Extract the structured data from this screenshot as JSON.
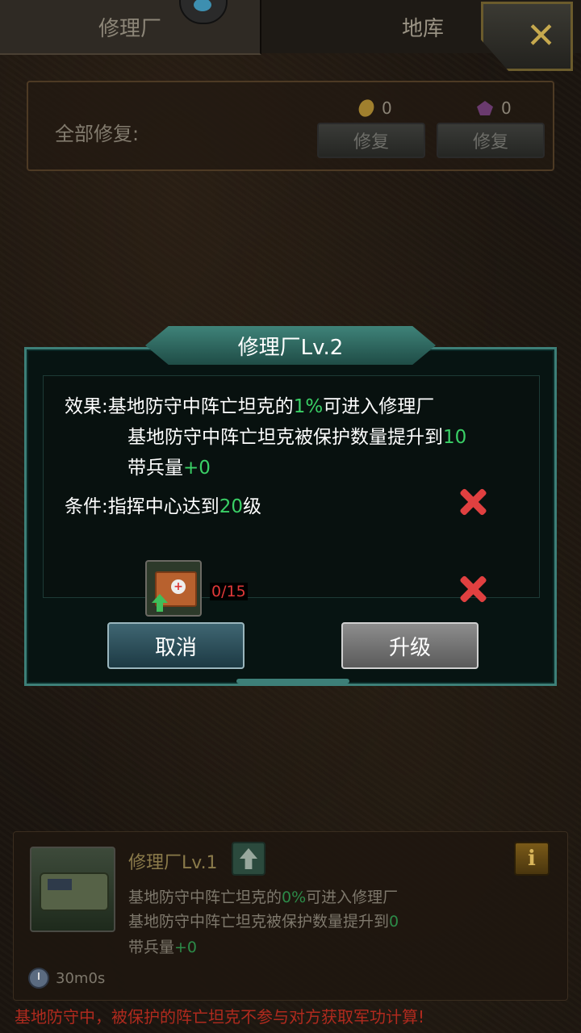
{
  "tabs": {
    "repair_factory": "修理厂",
    "garage": "地库"
  },
  "repair_all": {
    "label": "全部修复:",
    "gold_cost": "0",
    "crystal_cost": "0",
    "fix_button_1": "修复",
    "fix_button_2": "修复"
  },
  "dialog": {
    "title": "修理厂Lv.2",
    "effect_label": "效果:",
    "effect_line1_pre": "基地防守中阵亡坦克的",
    "effect_line1_value": "1%",
    "effect_line1_post": "可进入修理厂",
    "effect_line2_pre": "基地防守中阵亡坦克被保护数量提升到",
    "effect_line2_value": "10",
    "effect_line3_pre": "带兵量",
    "effect_line3_value": "+0",
    "condition_label": "条件:",
    "condition_pre": "指挥中心达到",
    "condition_value": "20",
    "condition_post": "级",
    "item_progress": "0/15",
    "cancel_button": "取消",
    "upgrade_button": "升级"
  },
  "info_panel": {
    "title": "修理厂Lv.1",
    "line1_pre": "基地防守中阵亡坦克的",
    "line1_value": "0%",
    "line1_post": "可进入修理厂",
    "line2_pre": "基地防守中阵亡坦克被保护数量提升到",
    "line2_value": "0",
    "line3_pre": "带兵量",
    "line3_value": "+0",
    "timer": "30m0s",
    "info_icon": "i"
  },
  "warning": "基地防守中，被保护的阵亡坦克不参与对方获取军功计算!",
  "icons": [
    "close-icon",
    "gold-coin-icon",
    "crystal-icon",
    "fail-cross-icon",
    "repair-crate-icon",
    "upgrade-arrow-icon",
    "info-icon",
    "clock-icon"
  ],
  "colors": {
    "highlight": "#3ad066",
    "fail": "#e04040",
    "dialog_border": "#3d7f78"
  }
}
